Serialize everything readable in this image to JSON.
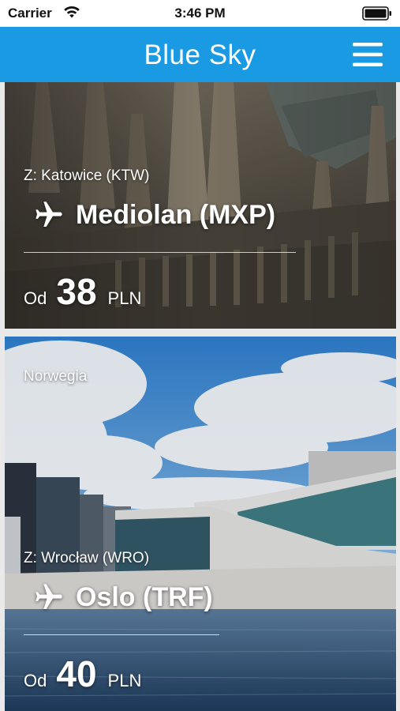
{
  "status_bar": {
    "carrier": "Carrier",
    "time": "3:46 PM"
  },
  "nav": {
    "title": "Blue Sky",
    "menu_icon": "hamburger-menu-icon",
    "background_color": "#1a9ae3"
  },
  "cards": [
    {
      "origin": "Z: Katowice (KTW)",
      "destination": "Mediolan (MXP)",
      "price_from_label": "Od",
      "price": "38",
      "currency": "PLN"
    },
    {
      "region": "Norwegia",
      "origin": "Z: Wrocław (WRO)",
      "destination": "Oslo (TRF)",
      "price_from_label": "Od",
      "price": "40",
      "currency": "PLN"
    }
  ]
}
